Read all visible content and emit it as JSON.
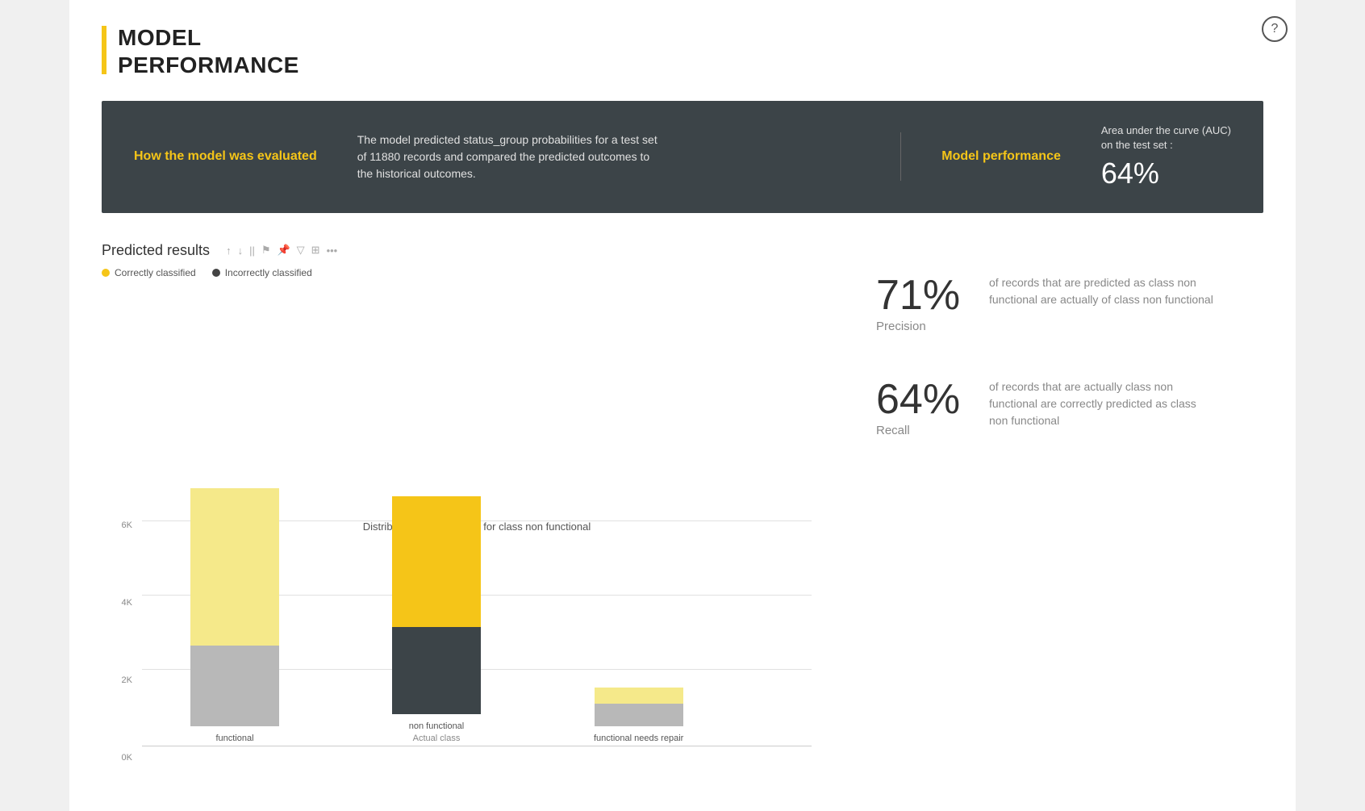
{
  "page": {
    "title_line1": "MODEL",
    "title_line2": "PERFORMANCE"
  },
  "banner": {
    "how_label": "How the model was evaluated",
    "description": "The model predicted status_group probabilities for a test set of 11880 records and compared the predicted outcomes to the historical outcomes.",
    "performance_label": "Model performance",
    "auc_title": "Area under the curve (AUC)\non the test set :",
    "auc_value": "64%"
  },
  "chart": {
    "title": "Predicted results",
    "legend": [
      {
        "label": "Correctly classified",
        "color": "#f5e17a"
      },
      {
        "label": "Incorrectly classified",
        "color": "#555555"
      }
    ],
    "toolbar_icons": [
      "↑",
      "↓",
      "||",
      "⚑",
      "📌",
      "▽",
      "⊞",
      "•••"
    ],
    "y_axis_labels": [
      "0K",
      "2K",
      "4K",
      "6K"
    ],
    "bars": [
      {
        "label": "functional",
        "sublabel": "",
        "correct_height": 210,
        "incorrect_height": 100,
        "correct_color": "#f5e17a",
        "incorrect_color": "#b0b0b0"
      },
      {
        "label": "non functional",
        "sublabel": "Actual class",
        "correct_height": 170,
        "incorrect_height": 110,
        "correct_color": "#f5c518",
        "incorrect_color": "#3c4448"
      },
      {
        "label": "functional needs repair",
        "sublabel": "",
        "correct_height": 22,
        "incorrect_height": 30,
        "correct_color": "#f5e17a",
        "incorrect_color": "#b0b0b0"
      }
    ],
    "bottom_label": "Distribution of predictions for class non functional"
  },
  "stats": [
    {
      "value": "71%",
      "label": "Precision",
      "description": "of records that are predicted as class non functional are actually of class non functional"
    },
    {
      "value": "64%",
      "label": "Recall",
      "description": "of records that are actually class non functional are correctly predicted as class non functional"
    }
  ],
  "help_button": "?"
}
